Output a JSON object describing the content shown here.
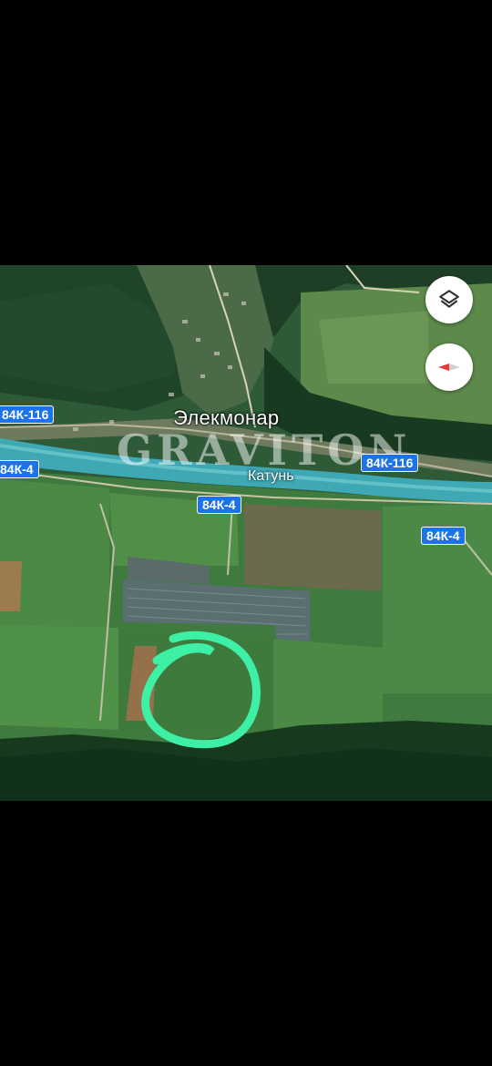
{
  "map": {
    "place_name": "Элекмонар",
    "river_name": "Катунь",
    "watermark": "GRAVITON",
    "road_labels": {
      "r1": "84К-116",
      "r2": "84К-4",
      "r3": "84К-116",
      "r4": "84К-4",
      "r5": "84К-4"
    },
    "highlight_color": "#3ef0a6"
  },
  "controls": {
    "layers_icon": "layers-icon",
    "compass_icon": "compass-icon"
  }
}
